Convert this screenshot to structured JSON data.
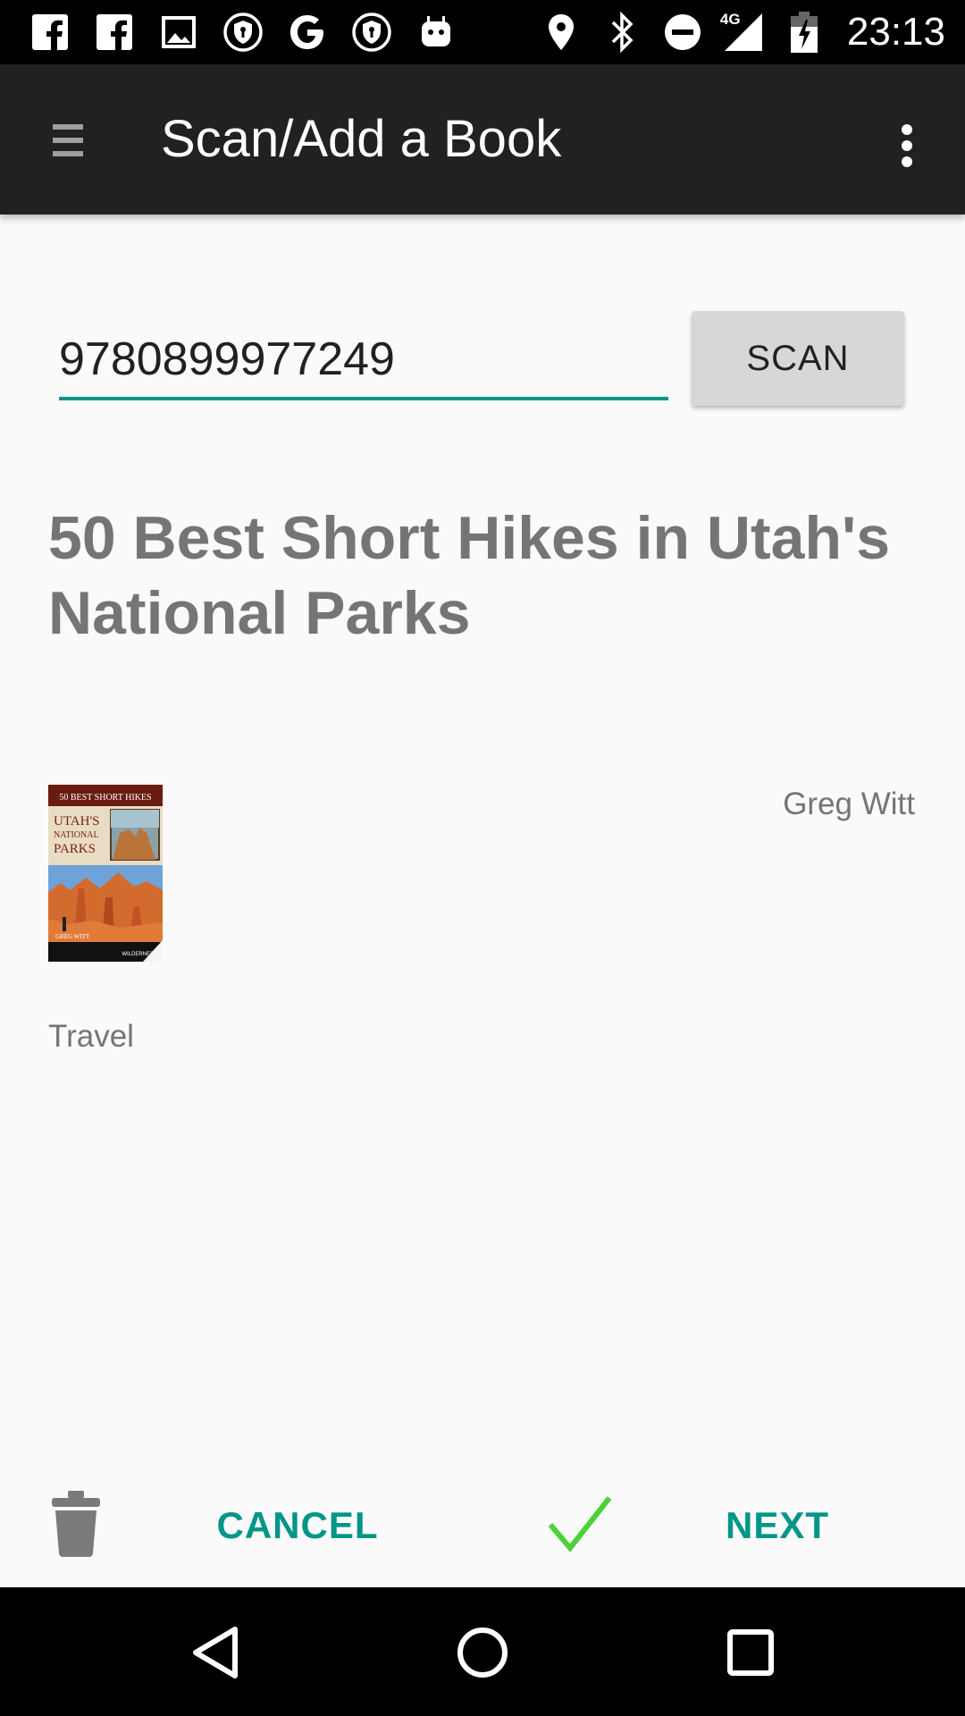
{
  "status_bar": {
    "left_icons": [
      "facebook-icon",
      "facebook-icon",
      "image-icon",
      "shield-icon",
      "google-icon",
      "shield-icon",
      "android-icon"
    ],
    "right_icons": [
      "location-icon",
      "bluetooth-icon",
      "do-not-disturb-icon",
      "4g-signal-icon",
      "battery-charging-icon"
    ],
    "network_label": "4G",
    "time": "23:13"
  },
  "app_bar": {
    "title": "Scan/Add a Book",
    "menu_icon": "hamburger-menu-icon",
    "overflow_icon": "more-vert-icon"
  },
  "isbn_input": {
    "value": "9780899977249"
  },
  "scan_button": {
    "label": "SCAN"
  },
  "book": {
    "title": "50 Best Short Hikes in Utah's National Parks",
    "author": "Greg Witt",
    "category": "Travel",
    "cover": {
      "top_text": "50 BEST SHORT HIKES",
      "title_line1": "UTAH'S",
      "title_line2": "NATIONAL",
      "title_line3": "PARKS",
      "author_text": "GREG WITT",
      "publisher_text": "WILDERNESS"
    }
  },
  "actions": {
    "delete_icon": "trash-icon",
    "cancel_label": "CANCEL",
    "confirm_icon": "check-icon",
    "next_label": "NEXT"
  },
  "nav_bar": {
    "back_icon": "back-icon",
    "home_icon": "home-icon",
    "recents_icon": "recents-icon"
  },
  "colors": {
    "accent": "#009688",
    "app_bar": "#212121",
    "check": "#4cd137",
    "text_secondary": "#757575"
  }
}
